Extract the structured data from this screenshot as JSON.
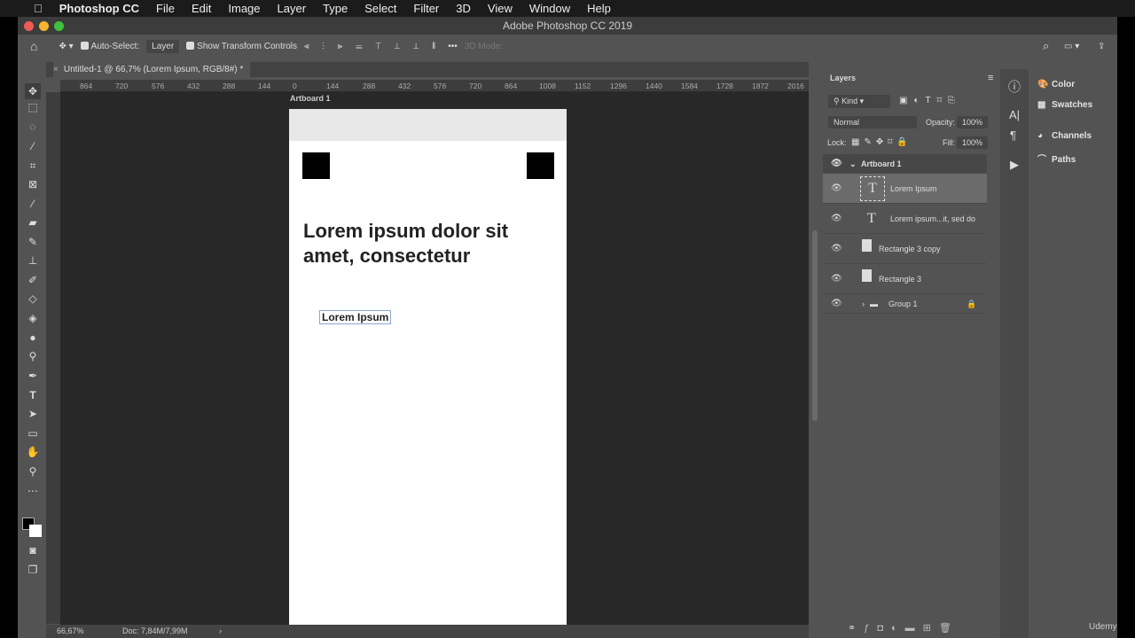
{
  "menubar": {
    "app": "Photoshop CC",
    "items": [
      "File",
      "Edit",
      "Image",
      "Layer",
      "Type",
      "Select",
      "Filter",
      "3D",
      "View",
      "Window",
      "Help"
    ]
  },
  "window": {
    "title": "Adobe Photoshop CC 2019"
  },
  "options": {
    "auto_select_label": "Auto-Select:",
    "auto_select_value": "Layer",
    "show_transform": "Show Transform Controls",
    "more": "•••",
    "mode_3d": "3D Mode:"
  },
  "document": {
    "tab_title": "Untitled-1 @ 66,7% (Lorem Ipsum, RGB/8#) *",
    "artboard_label": "Artboard 1",
    "heading": "Lorem ipsum dolor sit amet, consectetur",
    "selected_text": "Lorem Ipsum"
  },
  "ruler": {
    "top": [
      "864",
      "720",
      "576",
      "432",
      "288",
      "144",
      "0",
      "144",
      "288",
      "432",
      "576",
      "720",
      "864",
      "1008",
      "1152",
      "1296",
      "1440",
      "1584",
      "1728",
      "1872",
      "2016"
    ]
  },
  "status": {
    "zoom": "66,67%",
    "doc": "Doc: 7,84M/7,99M"
  },
  "layers_panel": {
    "tab": "Layers",
    "filter": "Kind",
    "blend": "Normal",
    "opacity_label": "Opacity:",
    "opacity": "100%",
    "lock_label": "Lock:",
    "fill_label": "Fill:",
    "fill": "100%",
    "layers": [
      {
        "name": "Artboard 1",
        "type": "artboard"
      },
      {
        "name": "Lorem Ipsum",
        "type": "text",
        "selected": true
      },
      {
        "name": "Lorem ipsum...it, sed do",
        "type": "text"
      },
      {
        "name": "Rectangle 3 copy",
        "type": "shape"
      },
      {
        "name": "Rectangle 3",
        "type": "shape"
      },
      {
        "name": "Group 1",
        "type": "group",
        "locked": true
      }
    ]
  },
  "right_panels": {
    "items": [
      "Color",
      "Swatches",
      "Channels",
      "Paths"
    ]
  },
  "watermark": "Udemy"
}
